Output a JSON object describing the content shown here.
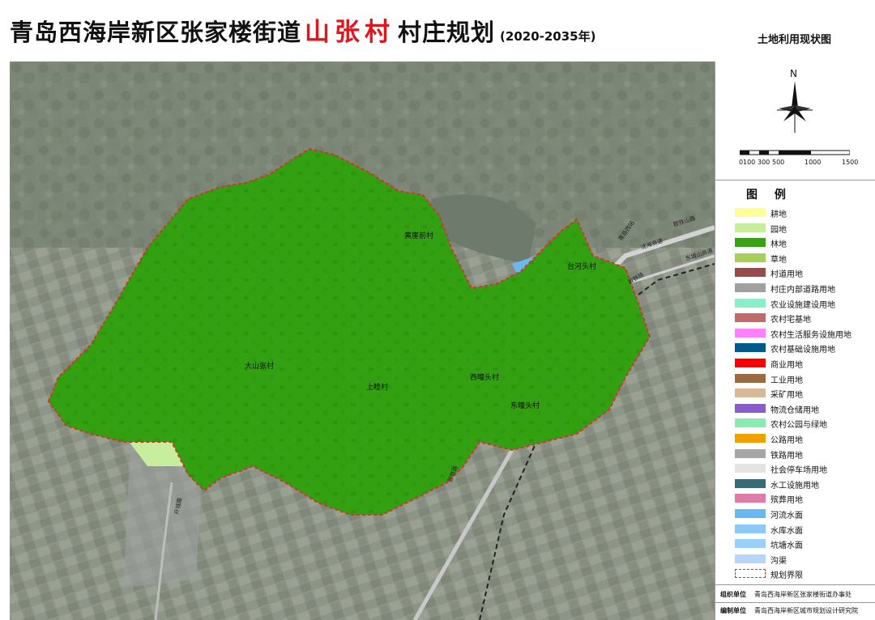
{
  "header": {
    "title_prefix": "青岛西海岸新区张家楼街道",
    "title_village": "山张村",
    "title_suffix": "村庄规划",
    "title_years": "(2020-2035年)",
    "map_kind": "土地利用现状图"
  },
  "compass": {
    "north_label": "N"
  },
  "scale_bar": {
    "labels": [
      "0",
      "100",
      "300",
      "500",
      "1000",
      "1500"
    ]
  },
  "legend": {
    "title": "图 例",
    "items": [
      {
        "label": "耕地",
        "color": "#ffff99"
      },
      {
        "label": "园地",
        "color": "#c6ee9c"
      },
      {
        "label": "林地",
        "color": "#3aa014"
      },
      {
        "label": "草地",
        "color": "#a8cf5a"
      },
      {
        "label": "村道用地",
        "color": "#9a4a4a"
      },
      {
        "label": "村庄内部道路用地",
        "color": "#a0a0a0"
      },
      {
        "label": "农业设施建设用地",
        "color": "#88f0c8"
      },
      {
        "label": "农村宅基地",
        "color": "#c06a6a"
      },
      {
        "label": "农村生活服务设施用地",
        "color": "#ff80ff"
      },
      {
        "label": "农村基础设施用地",
        "color": "#005a8c"
      },
      {
        "label": "商业用地",
        "color": "#ff0000"
      },
      {
        "label": "工业用地",
        "color": "#9c6a42"
      },
      {
        "label": "采矿用地",
        "color": "#d8b898"
      },
      {
        "label": "物流仓储用地",
        "color": "#8c5ad0"
      },
      {
        "label": "农村公园与绿地",
        "color": "#88ecb0"
      },
      {
        "label": "公路用地",
        "color": "#f0a000"
      },
      {
        "label": "铁路用地",
        "color": "#a6a6a6"
      },
      {
        "label": "社会停车场用地",
        "color": "#e4e4e4"
      },
      {
        "label": "水工设施用地",
        "color": "#3a6a78"
      },
      {
        "label": "殡葬用地",
        "color": "#e07aa8"
      },
      {
        "label": "河流水面",
        "color": "#6ab8f0"
      },
      {
        "label": "水库水面",
        "color": "#8ec8f6"
      },
      {
        "label": "坑塘水面",
        "color": "#98d0f8"
      },
      {
        "label": "沟渠",
        "color": "#b8d4f8"
      },
      {
        "label": "规划界限",
        "color": "#d83030"
      }
    ]
  },
  "credits": {
    "org_label": "组织单位",
    "org_value": "青岛西海岸新区张家楼街道办事处",
    "author_label": "编制单位",
    "author_value": "青岛西海岸新区城市规划设计研究院"
  },
  "map_labels": {
    "villages": [
      "黄崖前村",
      "台河头村",
      "大山张村",
      "上睦村",
      "西疃头村",
      "东疃头村"
    ],
    "roads": [
      "开城路",
      "胶铁山路",
      "沈海高速",
      "东城山高速",
      "胶铁路",
      "青岛西站",
      "胶铁路"
    ]
  }
}
